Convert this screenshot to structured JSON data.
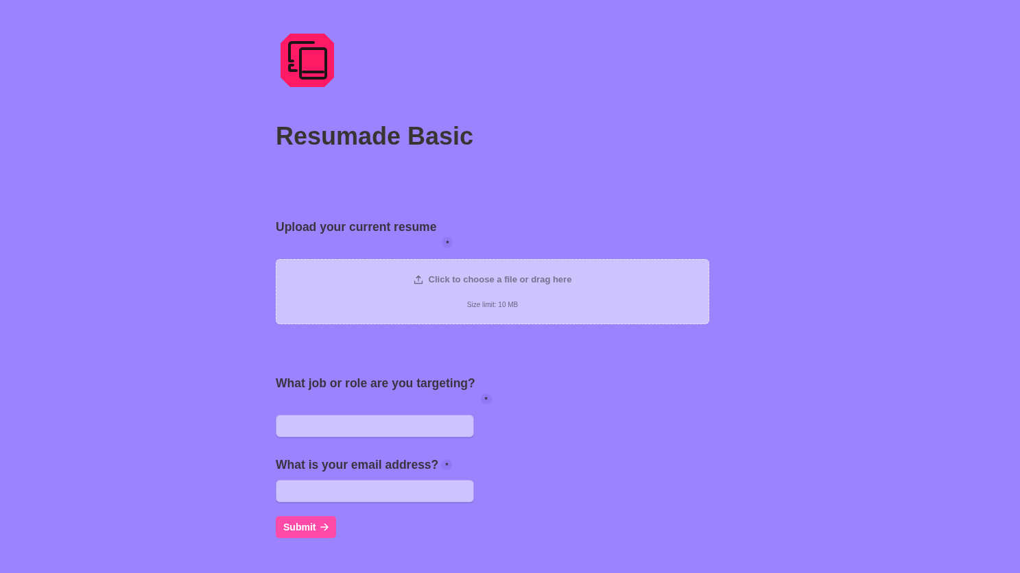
{
  "title": "Resumade Basic",
  "questions": [
    {
      "kind": "file",
      "label": "Upload your current resume",
      "required_mark": "*",
      "prompt": "Click to choose a file or drag here",
      "note": "Size limit: 10 MB"
    },
    {
      "kind": "text",
      "label": "What job or role are you targeting?",
      "required_mark": "*"
    },
    {
      "kind": "email",
      "label": "What is your email address?",
      "required_mark": "*"
    }
  ],
  "submit": {
    "label": "Submit"
  }
}
